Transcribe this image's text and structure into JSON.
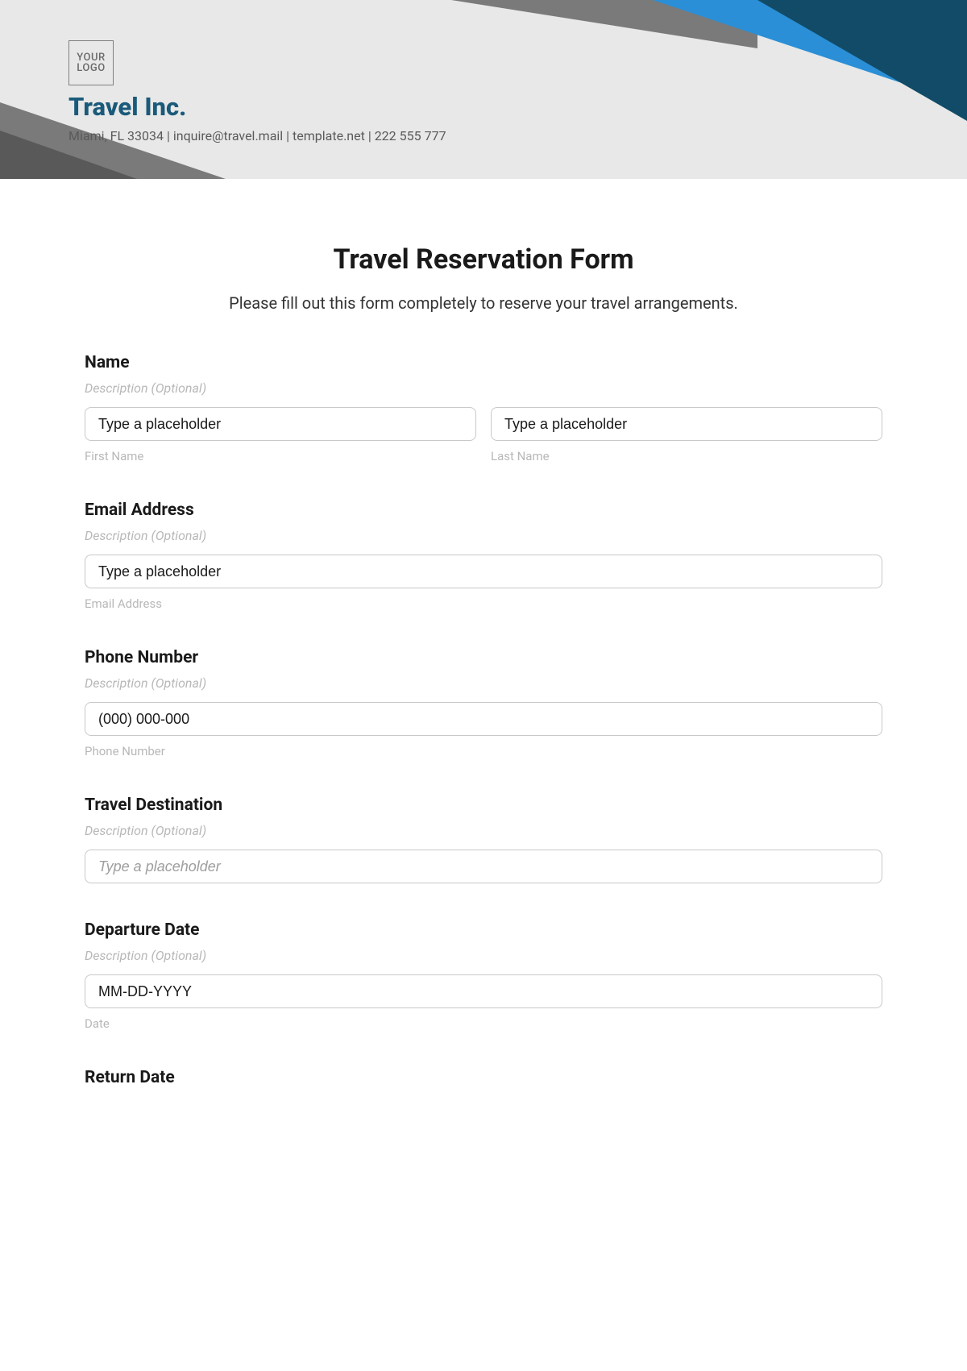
{
  "header": {
    "logo_top": "YOUR",
    "logo_bottom": "LOGO",
    "company": "Travel Inc.",
    "meta": "Miami, FL 33034 | inquire@travel.mail | template.net | 222 555 777"
  },
  "form": {
    "title": "Travel Reservation Form",
    "subtitle": "Please fill out this form completely to reserve your travel arrangements.",
    "name": {
      "label": "Name",
      "desc": "Description (Optional)",
      "first_placeholder": "Type a placeholder",
      "first_value": "Type a placeholder",
      "first_sub": "First Name",
      "last_placeholder": "Type a placeholder",
      "last_value": "Type a placeholder",
      "last_sub": "Last Name"
    },
    "email": {
      "label": "Email Address",
      "desc": "Description (Optional)",
      "placeholder": "Type a placeholder",
      "value": "Type a placeholder",
      "sub": "Email Address"
    },
    "phone": {
      "label": "Phone Number",
      "desc": "Description (Optional)",
      "placeholder": "(000) 000-000",
      "value": "(000) 000-000",
      "sub": "Phone Number"
    },
    "destination": {
      "label": "Travel Destination",
      "desc": "Description (Optional)",
      "placeholder": "Type a placeholder",
      "value": ""
    },
    "departure": {
      "label": "Departure Date",
      "desc": "Description (Optional)",
      "placeholder": "MM-DD-YYYY",
      "value": "MM-DD-YYYY",
      "sub": "Date"
    },
    "return_partial": "Return Date"
  }
}
